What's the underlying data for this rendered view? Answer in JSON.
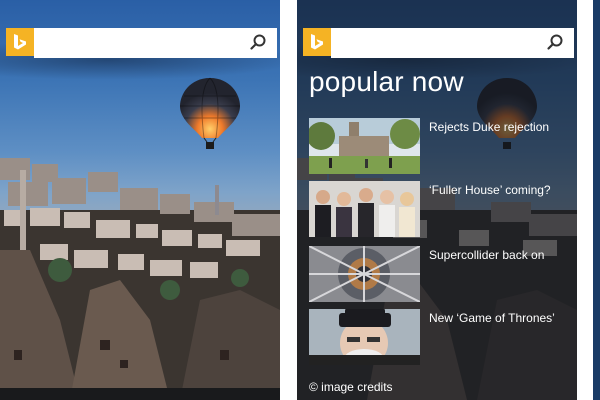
{
  "left_panel": {
    "search": {
      "value": "",
      "placeholder": ""
    },
    "icons": {
      "logo": "bing-logo-icon",
      "search": "search-icon"
    }
  },
  "right_panel": {
    "search": {
      "value": "",
      "placeholder": ""
    },
    "title": "popular now",
    "news": [
      {
        "headline": "Rejects Duke rejection",
        "thumb": "campus-photo"
      },
      {
        "headline": "‘Fuller House’ coming?",
        "thumb": "cast-photo"
      },
      {
        "headline": "Supercollider back on",
        "thumb": "collider-photo"
      },
      {
        "headline": "New ‘Game of Thrones’",
        "thumb": "author-photo"
      }
    ],
    "credits": "© image credits"
  },
  "colors": {
    "bing_tile": "#f5b324",
    "sky_top": "#2a5fa6",
    "overlay": "rgba(18,22,30,0.62)",
    "text": "#ffffff"
  }
}
